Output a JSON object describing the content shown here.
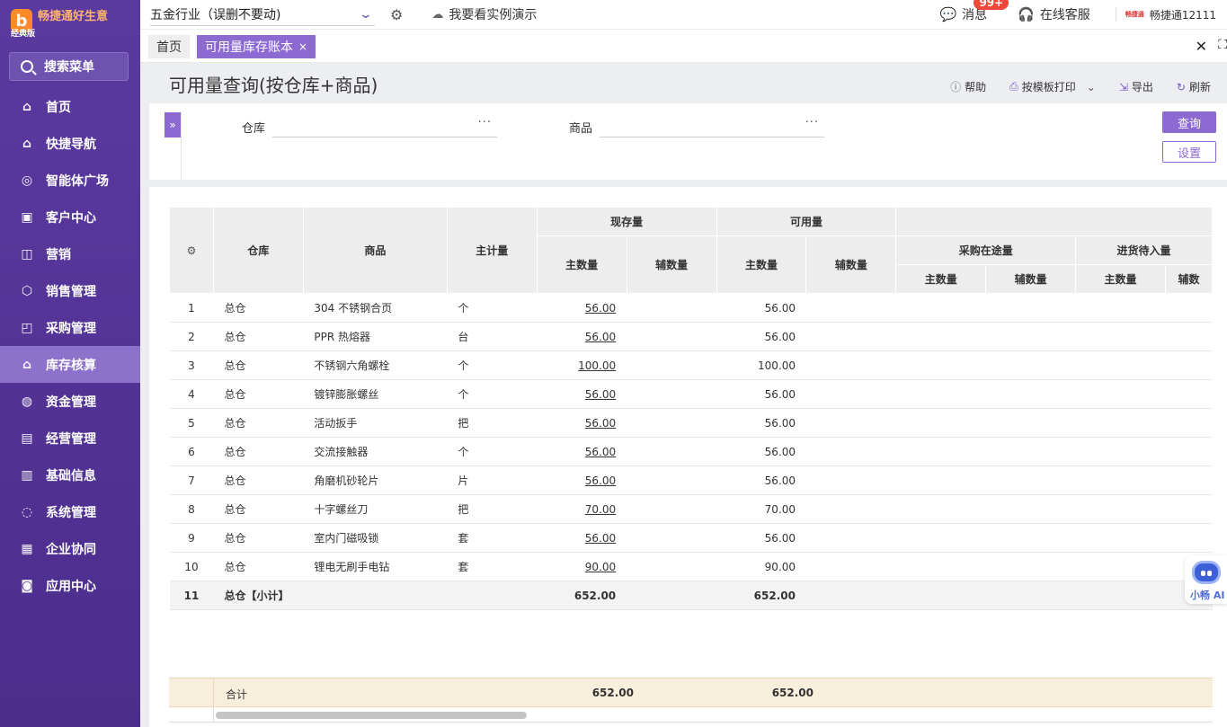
{
  "app": {
    "logo_text": "畅捷通好生意",
    "edition": "经典版",
    "logo_glyph": "b"
  },
  "sidebar": {
    "search_label": "搜索菜单",
    "items": [
      {
        "label": "首页",
        "icon": "home-icon",
        "glyph": "⌂"
      },
      {
        "label": "快捷导航",
        "icon": "quick-nav-icon",
        "glyph": "⌂"
      },
      {
        "label": "智能体广场",
        "icon": "ai-agent-icon",
        "glyph": "◎"
      },
      {
        "label": "客户中心",
        "icon": "briefcase-icon",
        "glyph": "▣"
      },
      {
        "label": "营销",
        "icon": "gift-icon",
        "glyph": "◫"
      },
      {
        "label": "销售管理",
        "icon": "sales-icon",
        "glyph": "⬡"
      },
      {
        "label": "采购管理",
        "icon": "shopping-bag-icon",
        "glyph": "◰"
      },
      {
        "label": "库存核算",
        "icon": "warehouse-icon",
        "glyph": "⌂"
      },
      {
        "label": "资金管理",
        "icon": "money-bag-icon",
        "glyph": "◍"
      },
      {
        "label": "经营管理",
        "icon": "clipboard-icon",
        "glyph": "▤"
      },
      {
        "label": "基础信息",
        "icon": "id-card-icon",
        "glyph": "▥"
      },
      {
        "label": "系统管理",
        "icon": "system-icon",
        "glyph": "◌"
      },
      {
        "label": "企业协同",
        "icon": "document-icon",
        "glyph": "▦"
      },
      {
        "label": "应用中心",
        "icon": "app-center-icon",
        "glyph": "◙"
      }
    ],
    "active_index": 7
  },
  "topbar": {
    "industry": "五金行业（误删不要动)",
    "demo_label": "我要看实例演示",
    "messages_label": "消息",
    "messages_badge": "99+",
    "service_label": "在线客服",
    "account_name": "畅捷通12111",
    "account_logo_text": "畅捷通"
  },
  "tabs": {
    "home": "首页",
    "active": "可用量库存账本",
    "close_glyph": "×"
  },
  "page": {
    "title": "可用量查询(按仓库+商品)",
    "actions": {
      "help": "帮助",
      "print": "按模板打印",
      "export": "导出",
      "refresh": "刷新"
    }
  },
  "filter": {
    "warehouse_label": "仓库",
    "warehouse_value": "",
    "product_label": "商品",
    "product_value": "",
    "query_button": "查询",
    "settings_button": "设置"
  },
  "table": {
    "headers": {
      "warehouse": "仓库",
      "product": "商品",
      "unit": "主计量",
      "on_hand": "现存量",
      "available": "可用量",
      "in_transit": "采购在途量",
      "pending_in": "进货待入量",
      "main_qty": "主数量",
      "aux_qty": "辅数量",
      "aux_qty_cut": "辅数"
    },
    "rows": [
      {
        "no": "1",
        "warehouse": "总仓",
        "product": "304 不锈钢合页",
        "unit": "个",
        "on_hand": "56.00",
        "available": "56.00"
      },
      {
        "no": "2",
        "warehouse": "总仓",
        "product": "PPR 热熔器",
        "unit": "台",
        "on_hand": "56.00",
        "available": "56.00"
      },
      {
        "no": "3",
        "warehouse": "总仓",
        "product": "不锈钢六角螺栓",
        "unit": "个",
        "on_hand": "100.00",
        "available": "100.00"
      },
      {
        "no": "4",
        "warehouse": "总仓",
        "product": "镀锌膨胀螺丝",
        "unit": "个",
        "on_hand": "56.00",
        "available": "56.00"
      },
      {
        "no": "5",
        "warehouse": "总仓",
        "product": "活动扳手",
        "unit": "把",
        "on_hand": "56.00",
        "available": "56.00"
      },
      {
        "no": "6",
        "warehouse": "总仓",
        "product": "交流接触器",
        "unit": "个",
        "on_hand": "56.00",
        "available": "56.00"
      },
      {
        "no": "7",
        "warehouse": "总仓",
        "product": "角磨机砂轮片",
        "unit": "片",
        "on_hand": "56.00",
        "available": "56.00"
      },
      {
        "no": "8",
        "warehouse": "总仓",
        "product": "十字螺丝刀",
        "unit": "把",
        "on_hand": "70.00",
        "available": "70.00"
      },
      {
        "no": "9",
        "warehouse": "总仓",
        "product": "室内门磁吸锁",
        "unit": "套",
        "on_hand": "56.00",
        "available": "56.00"
      },
      {
        "no": "10",
        "warehouse": "总仓",
        "product": "锂电无刷手电钻",
        "unit": "套",
        "on_hand": "90.00",
        "available": "90.00"
      }
    ],
    "subtotal": {
      "no": "11",
      "label": "总仓【小计】",
      "on_hand": "652.00",
      "available": "652.00"
    },
    "total": {
      "label": "合计",
      "on_hand": "652.00",
      "available": "652.00"
    }
  },
  "assistant": {
    "label": "小畅 AI"
  },
  "colors": {
    "accent": "#8d6ad1",
    "sidebar": "#5b3aa0",
    "total_bg": "#f8eedc"
  }
}
